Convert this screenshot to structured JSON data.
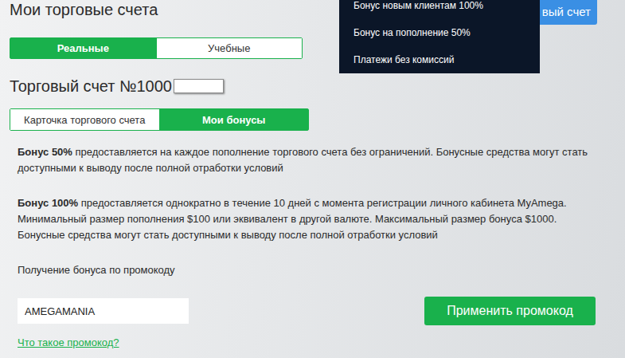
{
  "header": {
    "title": "Мои торговые счета",
    "open_account_button": "вый счет"
  },
  "menu": {
    "items": [
      "Бонус новым клиентам 100%",
      "Бонус на пополнение 50%",
      "Платежи без комиссий"
    ]
  },
  "account_type_tabs": [
    {
      "label": "Реальные",
      "selected": true
    },
    {
      "label": "Учебные",
      "selected": false
    }
  ],
  "account": {
    "title": "Торговый счет №1000"
  },
  "account_tabs": [
    {
      "label": "Карточка торгового счета",
      "selected": false
    },
    {
      "label": "Мои бонусы",
      "selected": true
    }
  ],
  "bonuses": [
    {
      "name": "Бонус 50%",
      "lines": [
        "предоставляется на каждое пополнение торгового счета без ограничений. Бонусные средства могут стать",
        "доступными к выводу после полной отработки условий"
      ]
    },
    {
      "name": "Бонус 100%",
      "lines": [
        "предоставляется однократно в течение 10 дней с момента регистрации личного кабинета MyAmega.",
        "Минимальный размер пополнения $100 или эквивалент в другой валюте. Максимальный размер бонуса $1000.",
        "Бонусные средства могут стать доступными к выводу после полной отработки условий"
      ]
    }
  ],
  "promo": {
    "label": "Получение бонуса по промокоду",
    "value": "AMEGAMANIA",
    "apply_button": "Применить промокод",
    "help_link": "Что такое промокод?"
  }
}
